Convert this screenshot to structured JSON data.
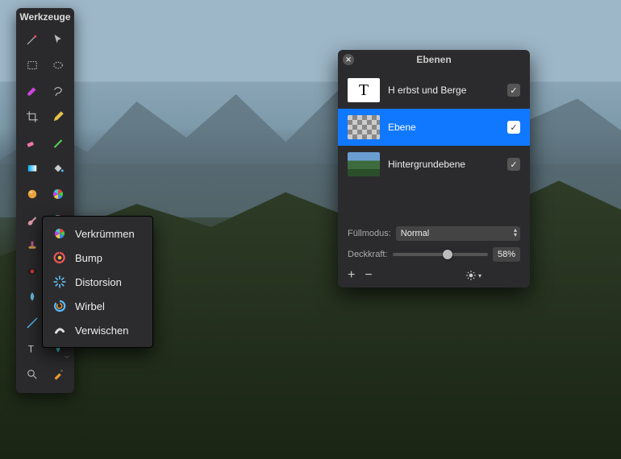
{
  "tools_panel": {
    "title": "Werkzeuge",
    "tools": [
      "wand-icon",
      "pointer-icon",
      "marquee-rect-icon",
      "marquee-ellipse-icon",
      "brush-icon",
      "lasso-icon",
      "crop-icon",
      "pen-icon",
      "eraser-icon",
      "pencil-icon",
      "gradient-icon",
      "bucket-icon",
      "sphere-icon",
      "pinwheel-icon",
      "paint-icon",
      "warp-icon",
      "clone-icon",
      "tool-extra-icon",
      "redeye-icon",
      "tool-extra2-icon",
      "blur-icon",
      "tool-extra3-icon",
      "line-icon",
      "tool-extra4-icon",
      "text-icon",
      "shape-icon",
      "zoom-icon",
      "eyedropper-icon"
    ]
  },
  "flyout": {
    "items": [
      {
        "label": "Verkrümmen",
        "icon": "pinwheel-icon"
      },
      {
        "label": "Bump",
        "icon": "swirl-red-icon"
      },
      {
        "label": "Distorsion",
        "icon": "spikes-icon"
      },
      {
        "label": "Wirbel",
        "icon": "swirl-blue-icon"
      },
      {
        "label": "Verwischen",
        "icon": "smear-icon"
      }
    ]
  },
  "layers_panel": {
    "title": "Ebenen",
    "layers": [
      {
        "name": "H erbst und Berge",
        "thumb": "T",
        "visible": true,
        "selected": false
      },
      {
        "name": "Ebene",
        "thumb": "checker",
        "visible": true,
        "selected": true
      },
      {
        "name": "Hintergrundebene",
        "thumb": "photo",
        "visible": true,
        "selected": false
      }
    ],
    "blend_label": "Füllmodus:",
    "blend_value": "Normal",
    "opacity_label": "Deckkraft:",
    "opacity_pct": "58%",
    "opacity_value": 58
  }
}
